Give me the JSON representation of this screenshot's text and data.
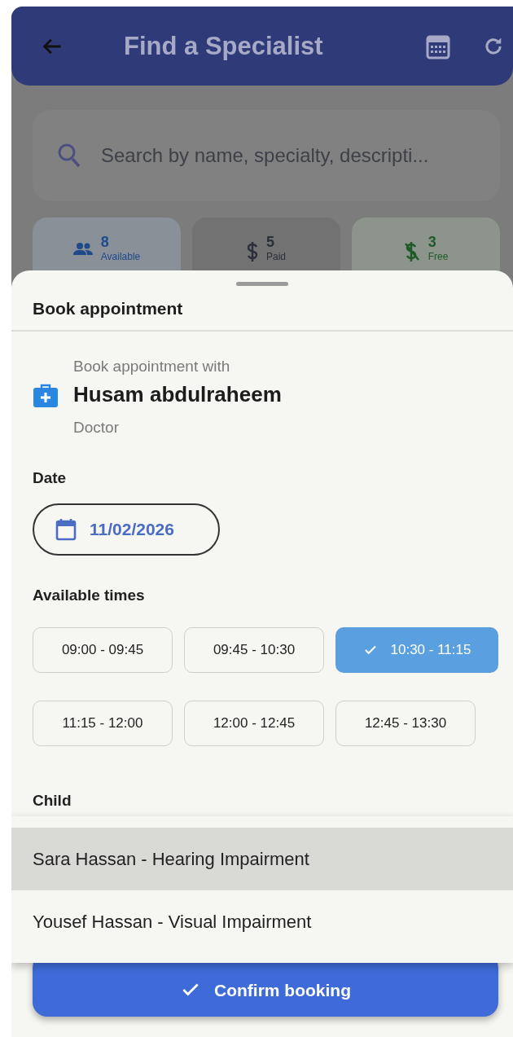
{
  "app_bar": {
    "title": "Find a Specialist"
  },
  "search": {
    "placeholder": "Search by name, specialty, descripti..."
  },
  "stats": [
    {
      "kind": "people",
      "count": "8",
      "label": "Available",
      "color": "#1f4a8a"
    },
    {
      "kind": "paid",
      "count": "5",
      "label": "Paid",
      "color": "#2a2f3a"
    },
    {
      "kind": "free",
      "count": "3",
      "label": "Free",
      "color": "#1e5a26"
    }
  ],
  "sheet": {
    "title": "Book appointment",
    "intro": "Book appointment with",
    "provider_name": "Husam abdulraheem",
    "provider_role": "Doctor",
    "date_label": "Date",
    "date_value": "11/02/2026",
    "times_label": "Available times",
    "times": [
      {
        "label": "09:00 - 09:45",
        "selected": false
      },
      {
        "label": "09:45 - 10:30",
        "selected": false
      },
      {
        "label": "10:30 - 11:15",
        "selected": true
      },
      {
        "label": "11:15 - 12:00",
        "selected": false
      },
      {
        "label": "12:00 - 12:45",
        "selected": false
      },
      {
        "label": "12:45 - 13:30",
        "selected": false
      }
    ],
    "child_label": "Child",
    "child_options": [
      {
        "label": "Sara Hassan - Hearing Impairment",
        "selected": true
      },
      {
        "label": "Yousef Hassan - Visual Impairment",
        "selected": false
      }
    ],
    "confirm_button": "Confirm booking"
  }
}
